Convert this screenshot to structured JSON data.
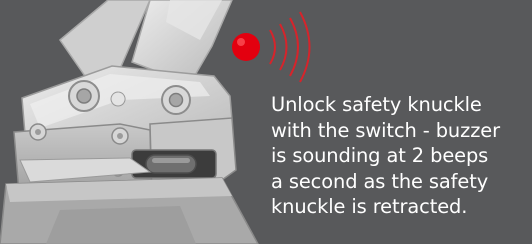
{
  "caption": {
    "lines": [
      "Unlock safety knuckle",
      "with the switch - buzzer",
      "is sounding at 2 beeps",
      "a second as the safety",
      "knuckle is retracted."
    ]
  },
  "colors": {
    "background": "#58595b",
    "metal_light": "#dcdcdc",
    "metal_mid": "#bdbdbd",
    "metal_dark": "#8e8e8e",
    "alarm_red": "#e3000f",
    "wave_red": "#d6242b"
  },
  "icons": {
    "alarm": "red-dot-with-sound-waves",
    "coupler": "quick-coupler-illustration"
  }
}
